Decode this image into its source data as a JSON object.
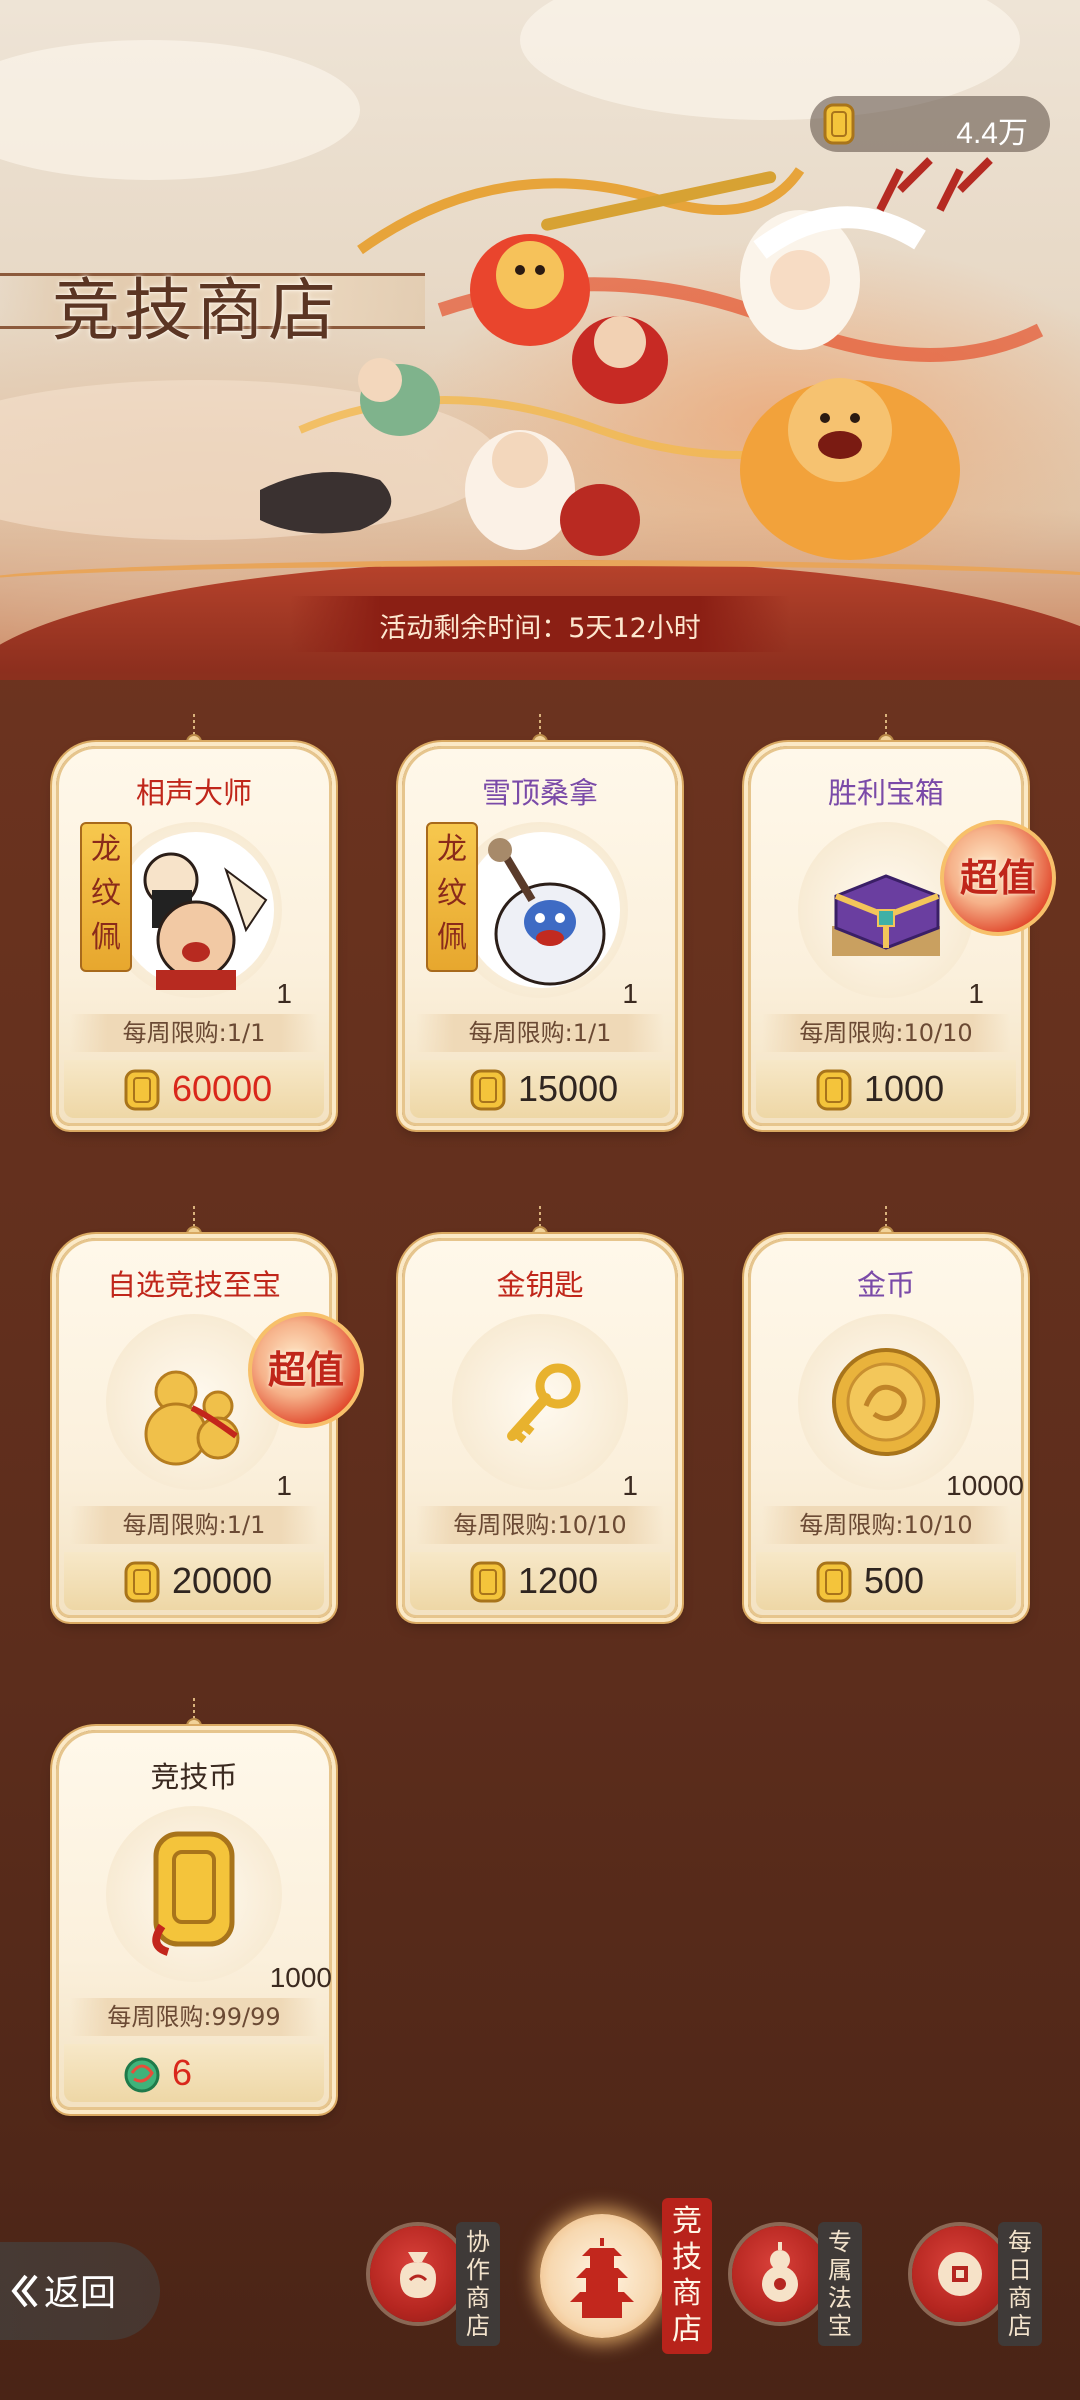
{
  "header": {
    "title": "竞技商店",
    "currency_amount": "4.4万",
    "timer_text": "活动剩余时间：5天12小时"
  },
  "items": [
    {
      "name": "相声大师",
      "name_color": "#c0261a",
      "qty": "1",
      "limit": "每周限购:1/1",
      "price": "60000",
      "price_red": true,
      "badge": "龙纹佩",
      "icon": "comedian-portrait-icon"
    },
    {
      "name": "雪顶桑拿",
      "name_color": "#7a4aa8",
      "qty": "1",
      "limit": "每周限购:1/1",
      "price": "15000",
      "price_red": false,
      "badge": "龙纹佩",
      "icon": "yeti-portrait-icon"
    },
    {
      "name": "胜利宝箱",
      "name_color": "#7a4aa8",
      "qty": "1",
      "limit": "每周限购:10/10",
      "price": "1000",
      "price_red": false,
      "badge_value": "超值",
      "icon": "purple-chest-icon"
    },
    {
      "name": "自选竞技至宝",
      "name_color": "#c0261a",
      "qty": "1",
      "limit": "每周限购:1/1",
      "price": "20000",
      "price_red": false,
      "badge_value": "超值",
      "icon": "gourd-icon"
    },
    {
      "name": "金钥匙",
      "name_color": "#c0261a",
      "qty": "1",
      "limit": "每周限购:10/10",
      "price": "1200",
      "price_red": false,
      "icon": "gold-key-icon"
    },
    {
      "name": "金币",
      "name_color": "#7a4aa8",
      "qty": "10000",
      "limit": "每周限购:10/10",
      "price": "500",
      "price_red": false,
      "icon": "gold-coin-icon"
    },
    {
      "name": "竞技币",
      "name_color": "#3b2a20",
      "qty": "1000",
      "limit": "每周限购:99/99",
      "price": "6",
      "price_red": true,
      "icon": "arena-token-icon",
      "price_icon": "jade-dragon-icon"
    }
  ],
  "nav": {
    "back_label": "返回",
    "tabs": [
      {
        "label": "协作商店",
        "icon": "money-bag-icon",
        "active": false
      },
      {
        "label": "竞技商店",
        "icon": "pagoda-icon",
        "active": true
      },
      {
        "label": "专属法宝",
        "icon": "gourd-treasure-icon",
        "active": false
      },
      {
        "label": "每日商店",
        "icon": "coin-icon",
        "active": false
      }
    ]
  },
  "colors": {
    "accent_red": "#b8231b",
    "price_red": "#d9271b",
    "background": "#6b331f"
  }
}
